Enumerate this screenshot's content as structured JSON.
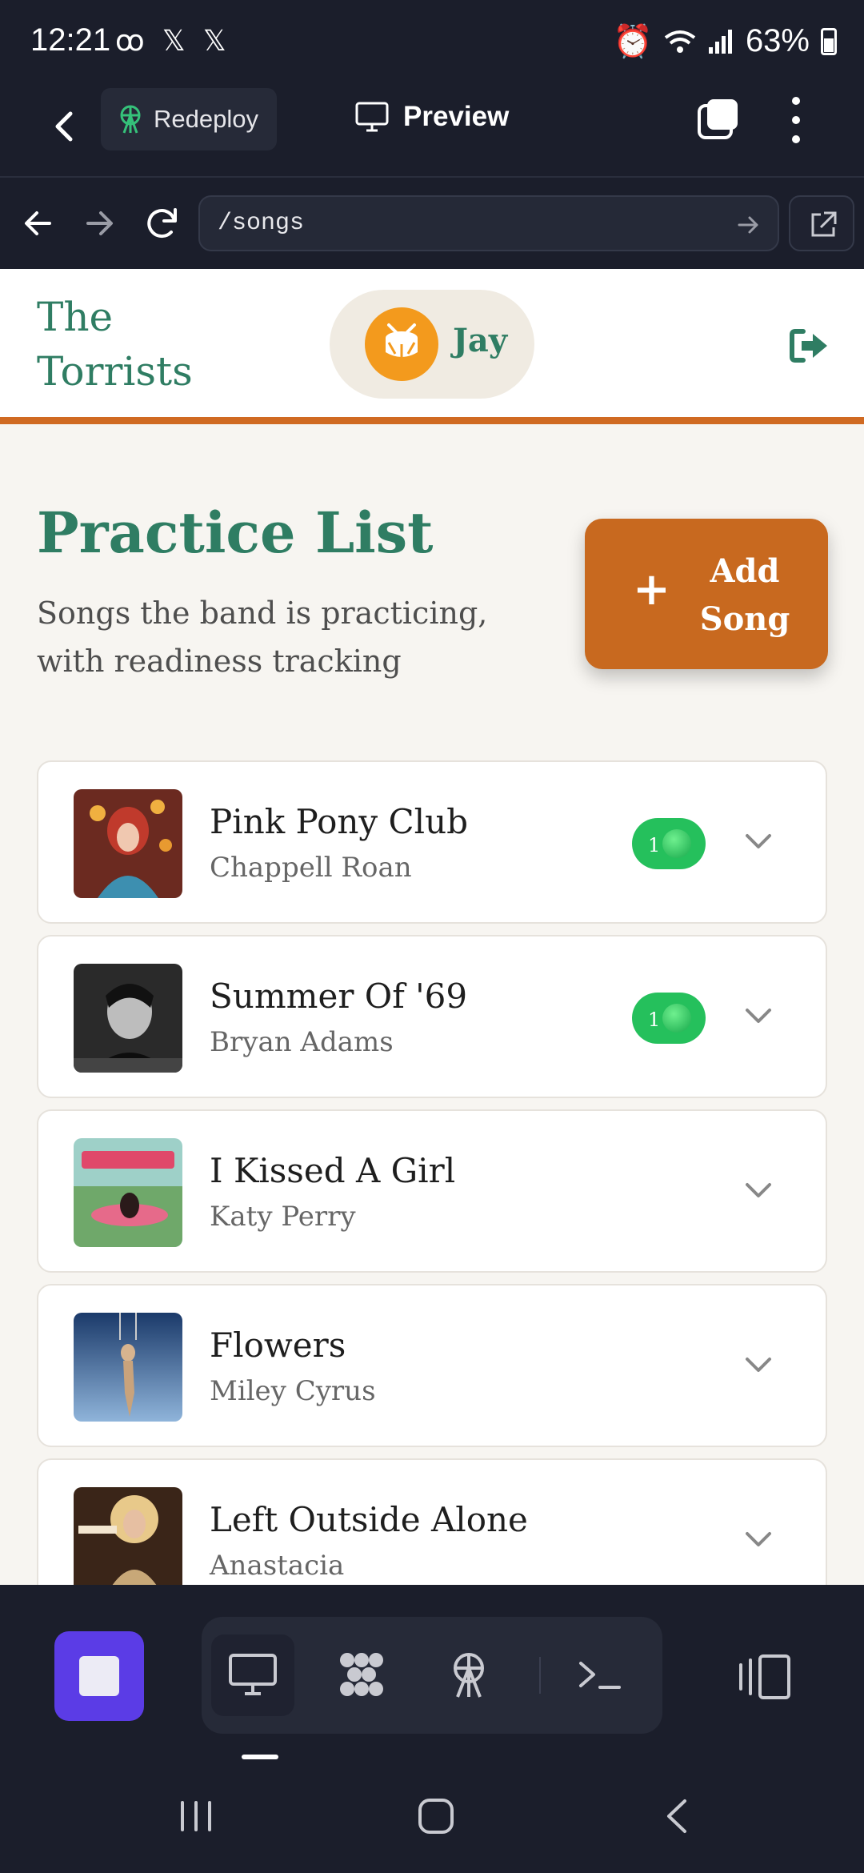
{
  "status_bar": {
    "time": "12:21",
    "left_icons": [
      "voicemail-icon",
      "x-icon",
      "x-icon"
    ],
    "battery": "63%"
  },
  "app_bar": {
    "redeploy_label": "Redeploy",
    "preview_label": "Preview"
  },
  "url_bar": {
    "url": "/songs"
  },
  "site": {
    "brand": "The Torrists",
    "user_name": "Jay",
    "page_title": "Practice List",
    "page_subtitle": "Songs the band is practicing, with readiness tracking",
    "add_button_label": "Add Song",
    "add_button_icon": "+"
  },
  "songs": [
    {
      "title": "Pink Pony Club",
      "artist": "Chappell Roan",
      "ready_count": "1"
    },
    {
      "title": "Summer Of '69",
      "artist": "Bryan Adams",
      "ready_count": "1"
    },
    {
      "title": "I Kissed A Girl",
      "artist": "Katy Perry",
      "ready_count": null
    },
    {
      "title": "Flowers",
      "artist": "Miley Cyrus",
      "ready_count": null
    },
    {
      "title": "Left Outside Alone",
      "artist": "Anastacia",
      "ready_count": null
    }
  ],
  "colors": {
    "accent_green": "#2f7d63",
    "accent_orange": "#c8691f",
    "ready_green": "#25c05c",
    "dock_purple": "#5b3ce6"
  }
}
